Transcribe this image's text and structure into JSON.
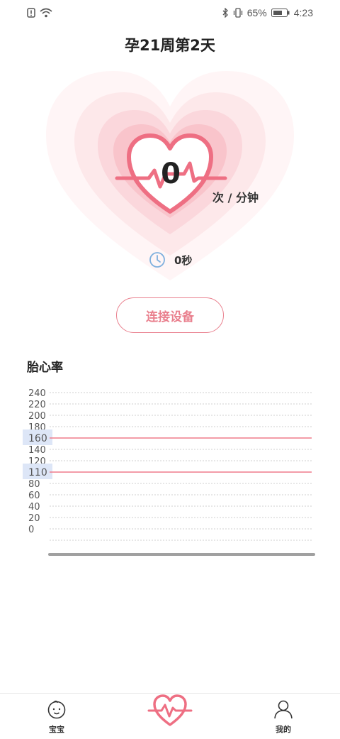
{
  "status_bar": {
    "battery_percent": "65%",
    "time": "4:23"
  },
  "header": {
    "title": "孕21周第2天"
  },
  "heart_rate": {
    "value": "0",
    "unit": "次 / 分钟",
    "timer": "0秒"
  },
  "connect_button": {
    "label": "连接设备"
  },
  "chart_section": {
    "title": "胎心率"
  },
  "chart_data": {
    "type": "line",
    "title": "胎心率",
    "y_ticks": [
      "240",
      "220",
      "200",
      "180",
      "160",
      "140",
      "120",
      "110",
      "80",
      "60",
      "40",
      "20",
      "0"
    ],
    "ylim": [
      0,
      240
    ],
    "reference_lines": [
      160,
      110
    ],
    "series": [],
    "grid": true,
    "colors": {
      "reference": "#ef7b8c",
      "grid": "#cfcfcf",
      "highlight": "#dde6f7"
    }
  },
  "bottom_nav": {
    "items": [
      {
        "label": "宝宝",
        "icon": "baby-face-icon"
      },
      {
        "label": "",
        "icon": "heartbeat-icon"
      },
      {
        "label": "我的",
        "icon": "user-icon"
      }
    ]
  },
  "colors": {
    "accent": "#ef7b8c",
    "heart_light": "#fde8ea"
  }
}
